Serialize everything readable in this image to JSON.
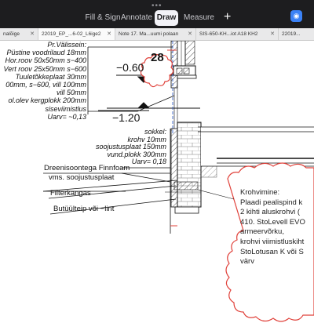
{
  "toolbar": {
    "tabs": [
      "Fill & Sign",
      "Annotate",
      "Draw",
      "Measure"
    ],
    "active_tab": "Draw",
    "add_label": "+"
  },
  "document_tabs": [
    "nalõige",
    "22019_EP_...6-02_L6ige2",
    "Note 17. Ma...uumi polaan",
    "SIS-650-KH...iot A18 KH2",
    "22019..."
  ],
  "drawing": {
    "detail_number": "28",
    "level_upper": "−0.60",
    "level_lower": "−1.20",
    "wall_layers": [
      "Pr.Välissein:",
      "Püstine voodrilaud 18mm",
      "Hor.roov 50x50mm  s−400",
      "Vert roov 25x50mm  s−600",
      "Tuuletõkkeplaat  30mm",
      "00mm, s−600, vill  100mm",
      "vill  50mm",
      "ol.olev kergplokk  200mm",
      "siseviimistlus",
      "Uarv= ~0,13"
    ],
    "plinth_layers": [
      "sokkel:",
      "krohv  10mm",
      "soojustusplaat  150mm",
      "vund.plokk  300mm",
      "Uarv=  0,18"
    ],
    "callouts": [
      "Dreenisoontega  Finnfoam",
      "vms.  soojustusplaat",
      "Filterkangas",
      "Butüülteip  või  −lint"
    ],
    "cloud_note": [
      "Krohvimine:",
      "Plaadi  pealispind  k",
      "2  kihti aluskrohvi  (",
      "410.  StoLevell  EVO",
      "armeervõrku,",
      "krohvi  viimistluskiht",
      "StoLotusan  K  või  S",
      "värv"
    ]
  },
  "colors": {
    "toolbar_bg": "#1d1d1f",
    "cloud_red": "#e0413a",
    "hatch": "#333333"
  }
}
